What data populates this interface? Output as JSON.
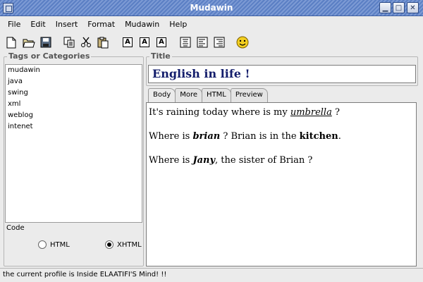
{
  "window": {
    "title": "Mudawin",
    "controls": [
      "minimize-icon",
      "maximize-icon",
      "close-icon"
    ]
  },
  "menu": [
    "File",
    "Edit",
    "Insert",
    "Format",
    "Mudawin",
    "Help"
  ],
  "toolbar": {
    "icons": [
      "new-document-icon",
      "open-folder-icon",
      "save-icon",
      "copy-icon",
      "cut-icon",
      "paste-icon",
      "text-a-icon",
      "text-a-icon",
      "text-a-icon",
      "align-center-icon",
      "align-left-icon",
      "align-right-icon",
      "smiley-icon"
    ],
    "format_glyph": "A"
  },
  "tags_panel": {
    "title": "Tags or Categories",
    "items": [
      "mudawin",
      "java",
      "swing",
      "xml",
      "weblog",
      "intenet"
    ]
  },
  "code": {
    "label": "Code",
    "options": [
      {
        "label": "HTML",
        "selected": false
      },
      {
        "label": "XHTML",
        "selected": true
      }
    ]
  },
  "title_panel": {
    "title": "Title",
    "value": "English in life !"
  },
  "tabs": [
    {
      "label": "Body",
      "active": true
    },
    {
      "label": "More",
      "active": false
    },
    {
      "label": "HTML",
      "active": false
    },
    {
      "label": "Preview",
      "active": false
    }
  ],
  "editor": {
    "line1": {
      "before": "It's raining today where is my ",
      "emphasis": "umbrella",
      "after": " ?"
    },
    "line2": {
      "before": "Where is ",
      "emphasis": "brian",
      "middle": " ? Brian is in the ",
      "strong": "kitchen",
      "after": "."
    },
    "line3": {
      "before": "Where is ",
      "emphasis": "Jany",
      "after": ", the sister of Brian ?"
    }
  },
  "status": "the current profile is Inside ELAATIFI'S Mind! !!"
}
